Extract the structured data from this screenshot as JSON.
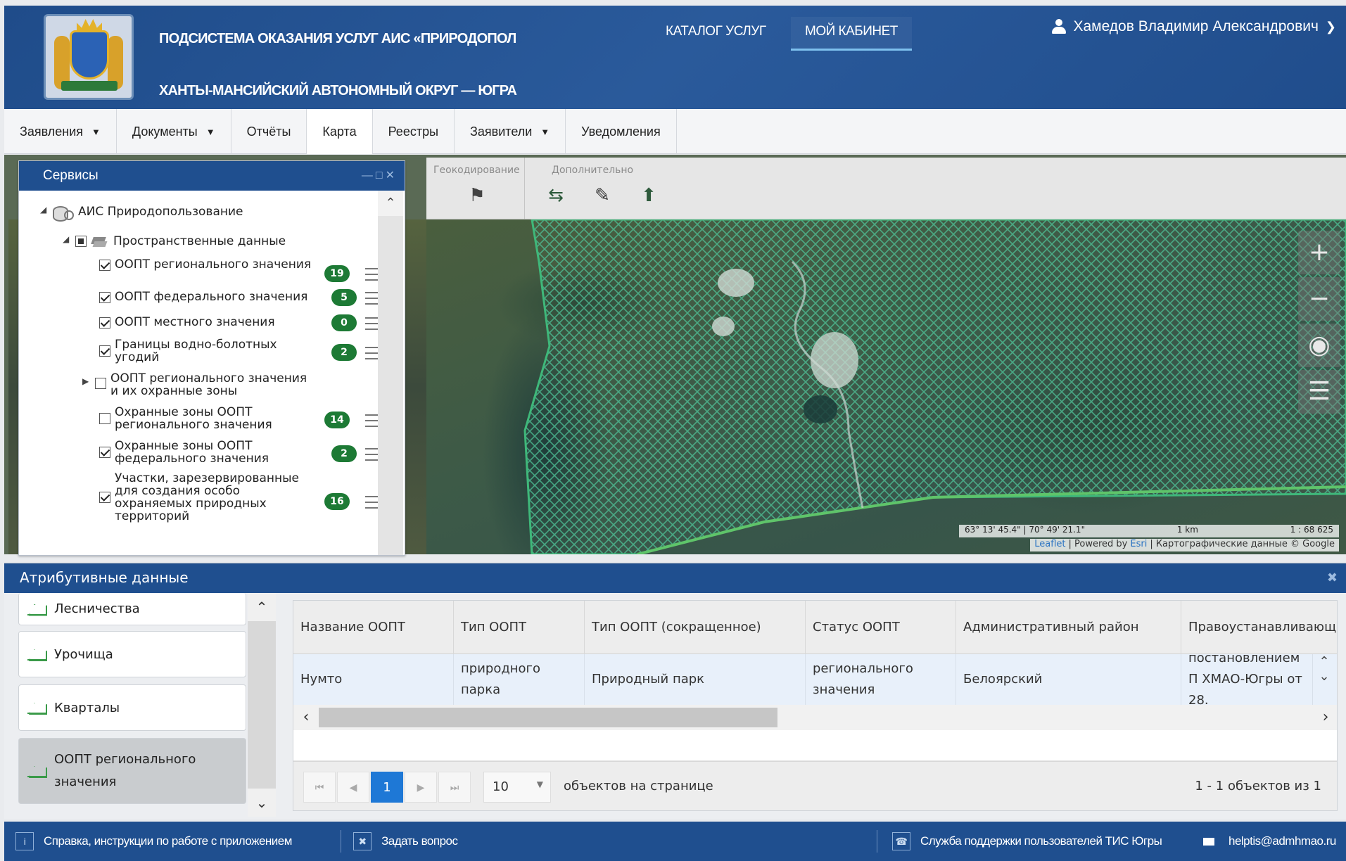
{
  "header": {
    "subsystem_title": "ПОДСИСТЕМА ОКАЗАНИЯ УСЛУГ АИС «ПРИРОДОПОЛ",
    "region_title": "ХАНТЫ-МАНСИЙСКИЙ АВТОНОМНЫЙ ОКРУГ — ЮГРА",
    "nav": {
      "catalog": "КАТАЛОГ УСЛУГ",
      "cabinet": "МОЙ КАБИНЕТ"
    },
    "user_name": "Хамедов Владимир Александрович"
  },
  "menu": {
    "items": [
      {
        "label": "Заявления",
        "caret": true
      },
      {
        "label": "Документы",
        "caret": true
      },
      {
        "label": "Отчёты",
        "caret": false
      },
      {
        "label": "Карта",
        "caret": false,
        "active": true
      },
      {
        "label": "Реестры",
        "caret": false
      },
      {
        "label": "Заявители",
        "caret": true
      },
      {
        "label": "Уведомления",
        "caret": false
      }
    ]
  },
  "map_toolbar": {
    "geocoding_label": "Геокодирование",
    "extra_label": "Дополнительно"
  },
  "services": {
    "title": "Сервисы",
    "root_label": "АИС Природопользование",
    "group_label": "Пространственные данные",
    "layers": [
      {
        "label": "ООПТ регионального значения",
        "checked": true,
        "count": "19"
      },
      {
        "label": "ООПТ федерального значения",
        "checked": true,
        "count": "5"
      },
      {
        "label": "ООПТ местного значения",
        "checked": true,
        "count": "0"
      },
      {
        "label": "Границы водно-болотных угодий",
        "checked": true,
        "count": "2"
      },
      {
        "label": "ООПТ регионального значения и их охранные зоны",
        "checked": false,
        "count": ""
      },
      {
        "label": "Охранные зоны ООПТ регионального значения",
        "checked": false,
        "count": "14"
      },
      {
        "label": "Охранные зоны ООПТ федерального значения",
        "checked": true,
        "count": "2"
      },
      {
        "label": "Участки, зарезервированные для создания особо охраняемых природных территорий",
        "checked": true,
        "count": "16"
      }
    ]
  },
  "map": {
    "coords": "63° 13' 45.4\" | 70° 49' 21.1\"",
    "scale_km": "1 km",
    "scale_ratio": "1 : 68 625",
    "attribution": {
      "leaflet": "Leaflet",
      "powered": "| Powered by",
      "esri": "Esri",
      "tiles": "| Картографические данные © Google"
    }
  },
  "attributes": {
    "title": "Атрибутивные данные",
    "list": [
      {
        "label": "Лесничества",
        "selected": false
      },
      {
        "label": "Урочища",
        "selected": false
      },
      {
        "label": "Кварталы",
        "selected": false
      },
      {
        "label": "ООПТ регионального значения",
        "selected": true
      }
    ],
    "columns": [
      "Название ООПТ",
      "Тип ООПТ",
      "Тип ООПТ (сокращенное)",
      "Статус ООПТ",
      "Административный район",
      "Правоустанавливающий"
    ],
    "row": [
      "Нумто",
      "природного парка",
      "Природный парк",
      "регионального значения",
      "Белоярский",
      "постановлением П ХМАО-Югры от 28."
    ],
    "pager": {
      "current_page": "1",
      "page_size": "10",
      "page_size_label": "объектов на странице",
      "info": "1 - 1 объектов из 1"
    }
  },
  "footer": {
    "help": "Справка, инструкции по работе с приложением",
    "ask": "Задать вопрос",
    "support": "Служба поддержки пользователей ТИС Югры",
    "email": "helptis@admhmao.ru"
  },
  "colors": {
    "brand_blue": "#1f4f8f",
    "badge_green": "#1d7a35",
    "accent_blue": "#1e78d6"
  }
}
